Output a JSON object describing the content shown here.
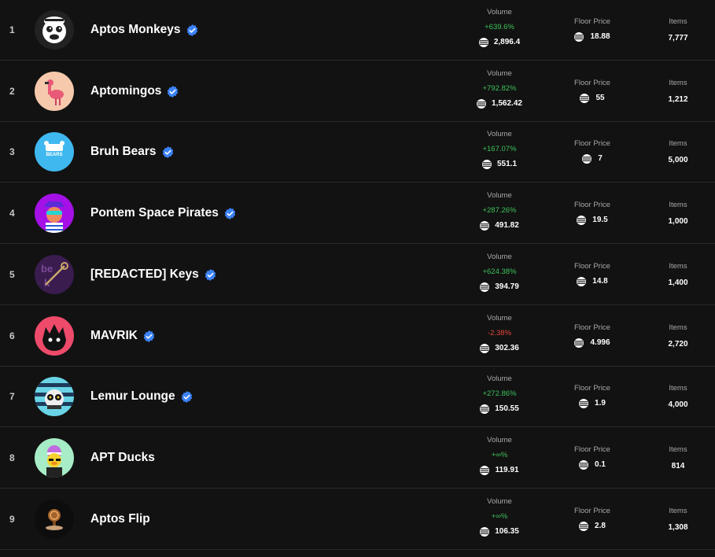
{
  "colors": {
    "background": "#121212",
    "divider": "#2a2a2a",
    "positive": "#3ec15a",
    "negative": "#e5483b",
    "verified": "#3b82f6"
  },
  "labels": {
    "volume": "Volume",
    "floor_price": "Floor Price",
    "items": "Items"
  },
  "icons": {
    "currency": "aptos-coin-icon",
    "verified": "verified-badge-icon"
  },
  "collections": [
    {
      "rank": "1",
      "name": "Aptos Monkeys",
      "verified": true,
      "avatar": "monkey-avatar",
      "volume_change": "+639.6%",
      "change_dir": "up",
      "volume": "2,896.4",
      "floor_price": "18.88",
      "items": "7,777"
    },
    {
      "rank": "2",
      "name": "Aptomingos",
      "verified": true,
      "avatar": "flamingo-avatar",
      "volume_change": "+792.82%",
      "change_dir": "up",
      "volume": "1,562.42",
      "floor_price": "55",
      "items": "1,212"
    },
    {
      "rank": "3",
      "name": "Bruh Bears",
      "verified": true,
      "avatar": "bruh-bears-avatar",
      "volume_change": "+167.07%",
      "change_dir": "up",
      "volume": "551.1",
      "floor_price": "7",
      "items": "5,000"
    },
    {
      "rank": "4",
      "name": "Pontem Space Pirates",
      "verified": true,
      "avatar": "pirate-avatar",
      "volume_change": "+287.26%",
      "change_dir": "up",
      "volume": "491.82",
      "floor_price": "19.5",
      "items": "1,000"
    },
    {
      "rank": "5",
      "name": "[REDACTED] Keys",
      "verified": true,
      "avatar": "keys-avatar",
      "volume_change": "+624.38%",
      "change_dir": "up",
      "volume": "394.79",
      "floor_price": "14.8",
      "items": "1,400"
    },
    {
      "rank": "6",
      "name": "MAVRIK",
      "verified": true,
      "avatar": "mavrik-avatar",
      "volume_change": "-2.38%",
      "change_dir": "down",
      "volume": "302.36",
      "floor_price": "4.996",
      "items": "2,720"
    },
    {
      "rank": "7",
      "name": "Lemur Lounge",
      "verified": true,
      "avatar": "lemur-avatar",
      "volume_change": "+272.86%",
      "change_dir": "up",
      "volume": "150.55",
      "floor_price": "1.9",
      "items": "4,000"
    },
    {
      "rank": "8",
      "name": "APT Ducks",
      "verified": false,
      "avatar": "duck-avatar",
      "volume_change": "+∞%",
      "change_dir": "up",
      "volume": "119.91",
      "floor_price": "0.1",
      "items": "814"
    },
    {
      "rank": "9",
      "name": "Aptos Flip",
      "verified": false,
      "avatar": "coin-flip-avatar",
      "volume_change": "+∞%",
      "change_dir": "up",
      "volume": "106.35",
      "floor_price": "2.8",
      "items": "1,308"
    }
  ]
}
